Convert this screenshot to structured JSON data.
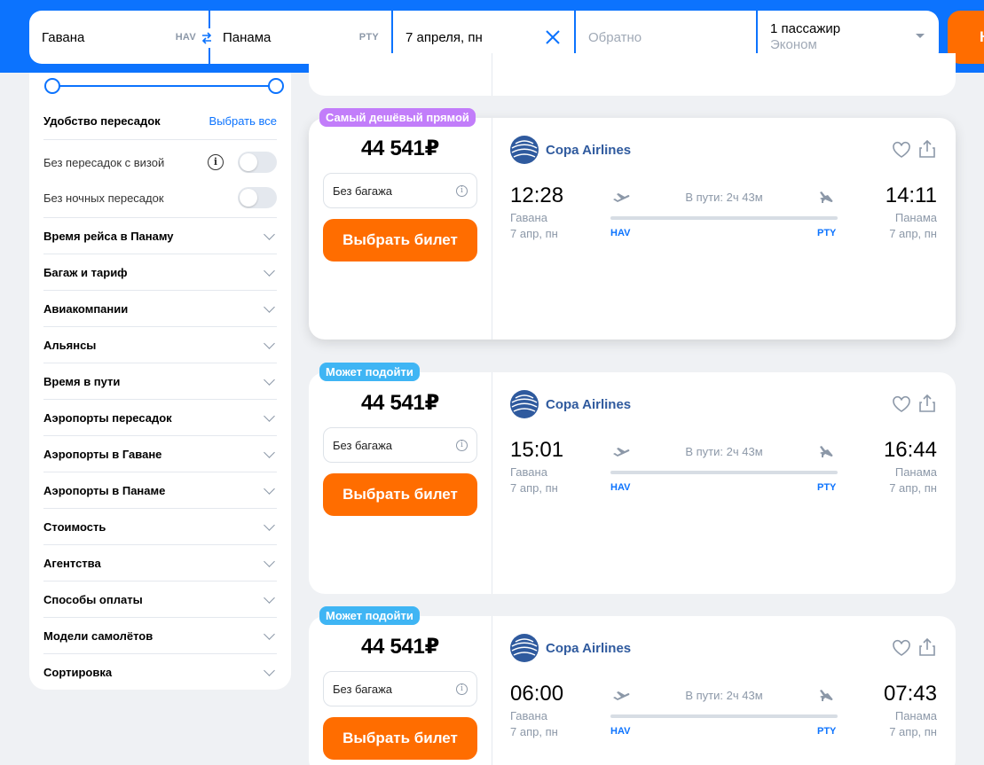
{
  "search": {
    "origin_city": "Гавана",
    "origin_iata": "HAV",
    "dest_city": "Панама",
    "dest_iata": "PTY",
    "date": "7 апреля, пн",
    "return_placeholder": "Обратно",
    "passengers": "1 пассажир",
    "cabin": "Эконом",
    "find_label": "Н"
  },
  "filters": {
    "transfers_title": "Удобство пересадок",
    "select_all": "Выбрать все",
    "toggles": [
      {
        "label": "Без пересадок с визой",
        "on": false
      },
      {
        "label": "Без ночных пересадок",
        "on": false
      }
    ],
    "sections": [
      "Время рейса в Панаму",
      "Багаж и тариф",
      "Авиакомпании",
      "Альянсы",
      "Время в пути",
      "Аэропорты пересадок",
      "Аэропорты в Гаване",
      "Аэропорты в Панаме",
      "Стоимость",
      "Агентства",
      "Способы оплаты",
      "Модели самолётов",
      "Сортировка"
    ]
  },
  "tickets": [
    {
      "badge": "Самый дешёвый прямой",
      "badge_color": "#c27dfa",
      "price": "44 541₽",
      "baggage": "Без багажа",
      "buy_label": "Выбрать билет",
      "airline": "Copa Airlines",
      "dep_time": "12:28",
      "arr_time": "14:11",
      "dep_city": "Гавана",
      "arr_city": "Панама",
      "dep_date": "7 апр, пн",
      "arr_date": "7 апр, пн",
      "duration": "В пути: 2ч 43м",
      "dep_iata": "HAV",
      "arr_iata": "PTY"
    },
    {
      "badge": "Может подойти",
      "badge_color": "#3fb5f4",
      "price": "44 541₽",
      "baggage": "Без багажа",
      "buy_label": "Выбрать билет",
      "airline": "Copa Airlines",
      "dep_time": "15:01",
      "arr_time": "16:44",
      "dep_city": "Гавана",
      "arr_city": "Панама",
      "dep_date": "7 апр, пн",
      "arr_date": "7 апр, пн",
      "duration": "В пути: 2ч 43м",
      "dep_iata": "HAV",
      "arr_iata": "PTY"
    },
    {
      "badge": "Может подойти",
      "badge_color": "#3fb5f4",
      "price": "44 541₽",
      "baggage": "Без багажа",
      "buy_label": "Выбрать билет",
      "airline": "Copa Airlines",
      "dep_time": "06:00",
      "arr_time": "07:43",
      "dep_city": "Гавана",
      "arr_city": "Панама",
      "dep_date": "7 апр, пн",
      "arr_date": "7 апр, пн",
      "duration": "В пути: 2ч 43м",
      "dep_iata": "HAV",
      "arr_iata": "PTY"
    }
  ],
  "colors": {
    "brand_blue": "#0c73fe",
    "cta_orange": "#ff6d00",
    "airline_blue": "#2f5a9e"
  }
}
